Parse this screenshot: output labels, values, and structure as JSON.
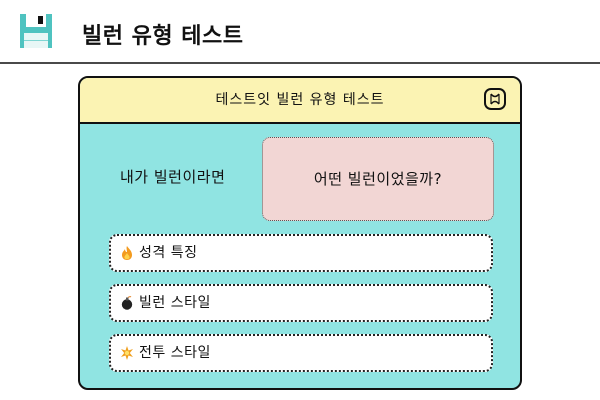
{
  "header": {
    "title": "빌런 유형 테스트",
    "icon": "floppy-disk-icon"
  },
  "card": {
    "title": "테스트잇 빌런 유형 테스트",
    "close_icon": "close-icon",
    "question": "내가 빌런이라면",
    "answer": "어떤 빌런이었을까?",
    "colors": {
      "body": "#90e4e2",
      "titlebar": "#fbf3b3",
      "answer_box": "#f2d6d4"
    },
    "options": [
      {
        "label": "성격 특징",
        "icon": "fire-icon"
      },
      {
        "label": "빌런 스타일",
        "icon": "bomb-icon"
      },
      {
        "label": "전투 스타일",
        "icon": "explosion-icon"
      }
    ]
  }
}
